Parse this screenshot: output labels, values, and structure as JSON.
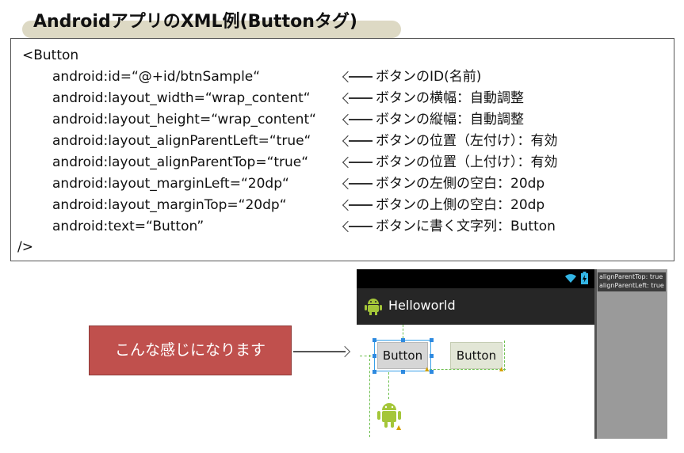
{
  "title": "AndroidアプリのXML例(Buttonタグ)",
  "code": {
    "open_tag": "<Button",
    "close_tag": "/>",
    "lines": [
      {
        "attr": "android:id=“@+id/btnSample“",
        "comment": "ボタンのID(名前)"
      },
      {
        "attr": "android:layout_width=“wrap_content“",
        "comment": "ボタンの横幅：自動調整"
      },
      {
        "attr": "android:layout_height=“wrap_content“",
        "comment": "ボタンの縦幅：自動調整"
      },
      {
        "attr": "android:layout_alignParentLeft=“true“",
        "comment": "ボタンの位置（左付け）：有効"
      },
      {
        "attr": "android:layout_alignParentTop=“true“",
        "comment": "ボタンの位置（上付け）：有効"
      },
      {
        "attr": "android:layout_marginLeft=“20dp“",
        "comment": "ボタンの左側の空白：20dp"
      },
      {
        "attr": "android:layout_marginTop=“20dp“",
        "comment": "ボタンの上側の空白：20dp"
      },
      {
        "attr": "android:text=“Button”",
        "comment": "ボタンに書く文字列：Button"
      }
    ]
  },
  "callout": {
    "label": "こんな感じになります"
  },
  "preview": {
    "app_title": "Helloworld",
    "button1_label": "Button",
    "button2_label": "Button",
    "props": [
      "alignParentTop: true",
      "alignParentLeft: true"
    ],
    "colors": {
      "statusbar": "#000000",
      "actionbar": "#262626",
      "selection": "#38a0e8",
      "guide": "#6fc050",
      "callout": "#c0504d"
    },
    "icons": [
      "wifi-icon",
      "battery-icon",
      "android-app-icon",
      "warning-icon",
      "android-robot-icon"
    ]
  }
}
